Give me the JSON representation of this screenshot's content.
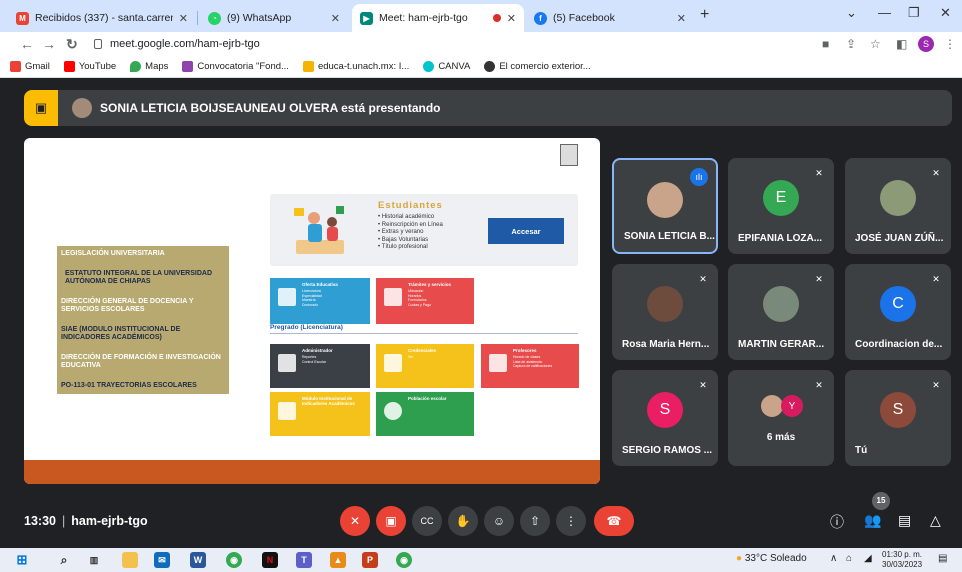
{
  "browser": {
    "tabs": [
      {
        "label": "Recibidos (337) - santa.carreno@...",
        "favicon": "gmail-icon",
        "color": "#ea4335"
      },
      {
        "label": "(9) WhatsApp",
        "favicon": "whatsapp-icon",
        "color": "#25d366"
      },
      {
        "label": "Meet: ham-ejrb-tgo",
        "favicon": "meet-icon",
        "color": "#00897b"
      },
      {
        "label": "(5) Facebook",
        "favicon": "facebook-icon",
        "color": "#1877f2"
      }
    ],
    "url": "meet.google.com/ham-ejrb-tgo",
    "bookmarks": [
      {
        "label": "Gmail",
        "color": "#ea4335"
      },
      {
        "label": "YouTube",
        "color": "#ff0000"
      },
      {
        "label": "Maps",
        "color": "#34a853"
      },
      {
        "label": "Convocatoria \"Fond...",
        "color": "#8e44ad"
      },
      {
        "label": "educa-t.unach.mx: I...",
        "color": "#f4b400"
      },
      {
        "label": "CANVA",
        "color": "#00c4cc"
      },
      {
        "label": "El comercio exterior...",
        "color": "#333333"
      }
    ]
  },
  "meet": {
    "presenting_text": "SONIA LETICIA BOIJSEAUNEAU OLVERA está presentando",
    "slide": {
      "menu_items": [
        "LEGISLACIÓN UNIVERSITARIA",
        "ESTATUTO INTEGRAL DE LA UNIVERSIDAD AUTÓNOMA DE CHIAPAS",
        "DIRECCIÓN GENERAL DE DOCENCIA Y SERVICIOS ESCOLARES",
        "SIAE (MODULO INSTITUCIONAL DE INDICADORES ACADÉMICOS)",
        "DIRECCIÓN DE FORMACIÓN E INVESTIGACIÓN EDUCATIVA",
        "PO-113-01 TRAYECTORIAS ESCOLARES"
      ],
      "estudiantes_title": "Estudiantes",
      "estudiantes_list": [
        "• Historial académico",
        "• Reinscripción en Línea",
        "• Extras y verano",
        "• Bajas Voluntarias",
        "• Título profesional"
      ],
      "acceder_label": "Accesar",
      "pregrado_label": "Pregrado (Licenciatura)",
      "modules": [
        {
          "title": "Oferta Educativa",
          "sub": "Licenciatura\nEspecialidad\nMaestría\nDoctorado",
          "color": "#2f9fd3"
        },
        {
          "title": "Trámites y servicios",
          "sub": "Ubicación\nHorarios\nFormularios\nCuotas y Pago",
          "color": "#e74b4b"
        },
        {
          "title": "Administrador",
          "sub": "Reportes\nControl Escolar",
          "color": "#3b3f46"
        },
        {
          "title": "Credenciales",
          "sub": "Ver",
          "color": "#f5c21b"
        },
        {
          "title": "Profesores",
          "sub": "Horario de clases\nLista de asistencia\nCaptura de calificaciones",
          "color": "#e74b4b"
        },
        {
          "title": "Módulo Institucional de Indicadores Académicos",
          "sub": "",
          "color": "#f5c21b"
        },
        {
          "title": "Población escolar",
          "sub": "",
          "color": "#2e9e4f"
        }
      ]
    },
    "participants": [
      {
        "name": "SONIA LETICIA B...",
        "initial": "",
        "color": "#c9a48a",
        "speaking": true
      },
      {
        "name": "EPIFANIA LOZA...",
        "initial": "E",
        "color": "#34a853",
        "speaking": false
      },
      {
        "name": "JOSÉ JUAN ZÚÑ...",
        "initial": "",
        "color": "#8d9a78",
        "speaking": false
      },
      {
        "name": "Rosa Maria Hern...",
        "initial": "",
        "color": "#6d4c3d",
        "speaking": false
      },
      {
        "name": "MARTIN GERAR...",
        "initial": "",
        "color": "#7a8a7a",
        "speaking": false
      },
      {
        "name": "Coordinacion de...",
        "initial": "C",
        "color": "#1a73e8",
        "speaking": false
      },
      {
        "name": "SERGIO RAMOS ...",
        "initial": "S",
        "color": "#e91e63",
        "speaking": false
      },
      {
        "name": "",
        "initial": "Y",
        "color": "#d81b60",
        "speaking": false,
        "more_label": "6 más"
      },
      {
        "name": "Tú",
        "initial": "S",
        "color": "#8d4a3a",
        "speaking": false
      }
    ],
    "time": "13:30",
    "meeting_code": "ham-ejrb-tgo",
    "participant_count": "15"
  },
  "taskbar": {
    "weather": "33°C Soleado",
    "time": "01:30 p. m.",
    "date": "30/03/2023"
  }
}
